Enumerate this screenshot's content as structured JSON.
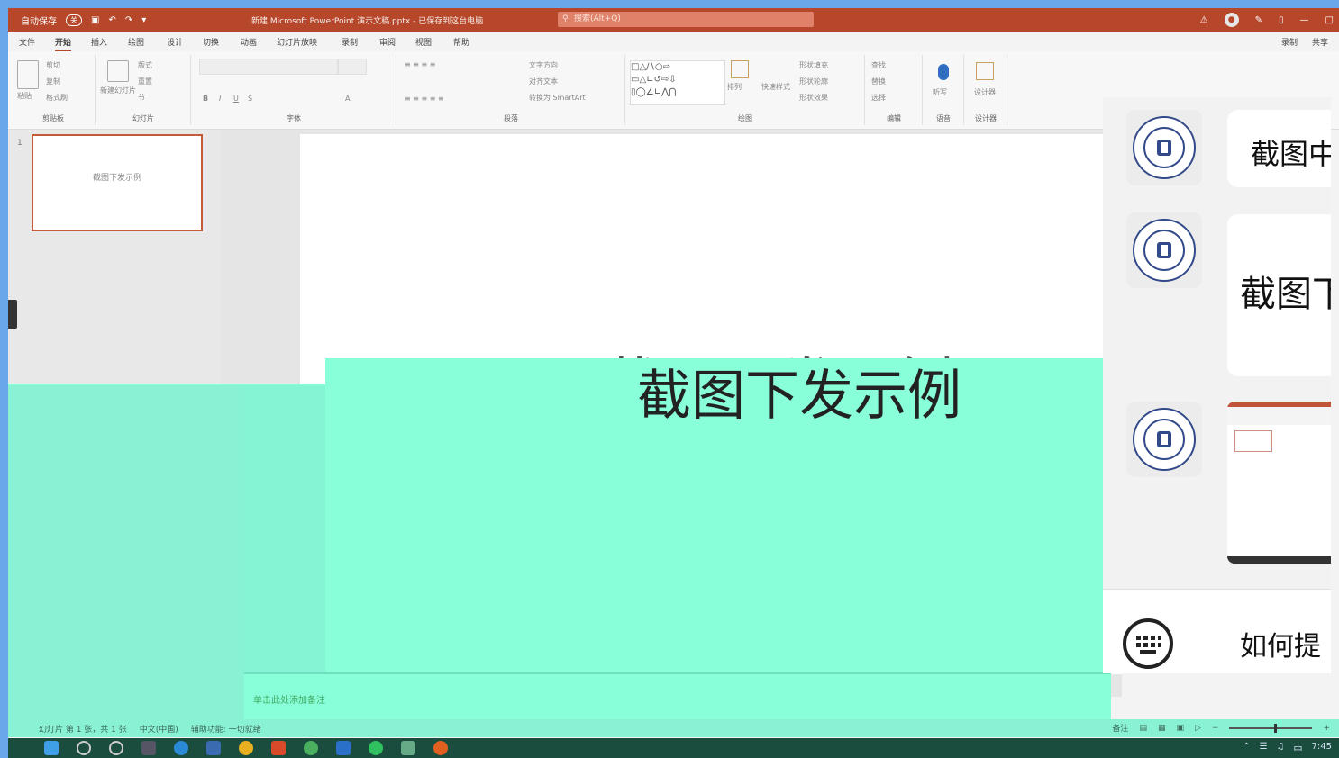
{
  "titlebar": {
    "autosave": "自动保存",
    "toggle": "关",
    "doc_title": "新建 Microsoft PowerPoint 演示文稿.pptx - 已保存到这台电脑",
    "search_placeholder": "搜索(Alt+Q)",
    "color": "#b7472a"
  },
  "tabs": [
    "文件",
    "开始",
    "插入",
    "绘图",
    "设计",
    "切换",
    "动画",
    "幻灯片放映",
    "录制",
    "审阅",
    "视图",
    "帮助"
  ],
  "tabs_right": [
    "录制",
    "共享"
  ],
  "ribbon": {
    "groups": [
      "剪贴板",
      "幻灯片",
      "字体",
      "段落",
      "绘图",
      "编辑",
      "语音",
      "设计器"
    ],
    "clipboard": [
      "粘贴",
      "剪切",
      "复制",
      "格式刷"
    ],
    "slides": [
      "新建幻灯片",
      "版式",
      "重置",
      "节"
    ],
    "paragraph": [
      "文字方向",
      "对齐文本",
      "转换为 SmartArt"
    ],
    "drawing": [
      "形状填充",
      "形状轮廓",
      "形状效果",
      "排列",
      "快速样式"
    ],
    "editing": [
      "查找",
      "替换",
      "选择"
    ],
    "voice": [
      "听写"
    ],
    "designer": [
      "设计器"
    ]
  },
  "thumbnail": {
    "number": "1",
    "text": "截图下发示例"
  },
  "slide": {
    "title": "截图下发示例"
  },
  "notes": {
    "placeholder": "单击此处添加备注"
  },
  "statusbar": {
    "slide_info": "幻灯片 第 1 张，共 1 张",
    "language": "中文(中国)",
    "accessibility": "辅助功能: 一切就绪",
    "notes_btn": "备注"
  },
  "chat": {
    "msg1": "截图中",
    "msg2": "截图下",
    "question": "如何提"
  },
  "taskbar": {
    "ime": "中",
    "time": "7:45"
  },
  "colors": {
    "overlay": "#88ffd9",
    "accent": "#b7472a",
    "background": "#6aa6ea"
  }
}
